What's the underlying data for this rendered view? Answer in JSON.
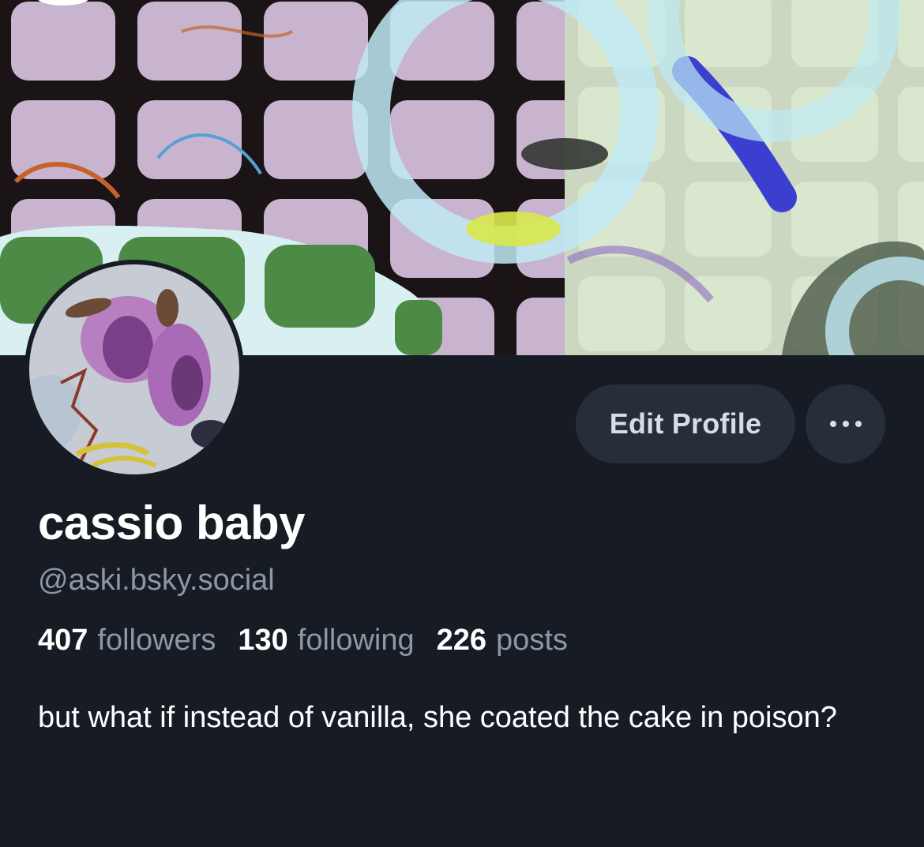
{
  "profile": {
    "display_name": "cassio baby",
    "handle": "@aski.bsky.social",
    "bio": "but what if instead of vanilla, she coated the cake in poison?"
  },
  "stats": {
    "followers_count": "407",
    "followers_label": "followers",
    "following_count": "130",
    "following_label": "following",
    "posts_count": "226",
    "posts_label": "posts"
  },
  "actions": {
    "edit_profile_label": "Edit Profile",
    "more_icon": "ellipsis-icon"
  },
  "colors": {
    "background": "#171c24",
    "button_bg": "#262e3a",
    "primary_text": "#ffffff",
    "secondary_text": "#8d97a5"
  }
}
